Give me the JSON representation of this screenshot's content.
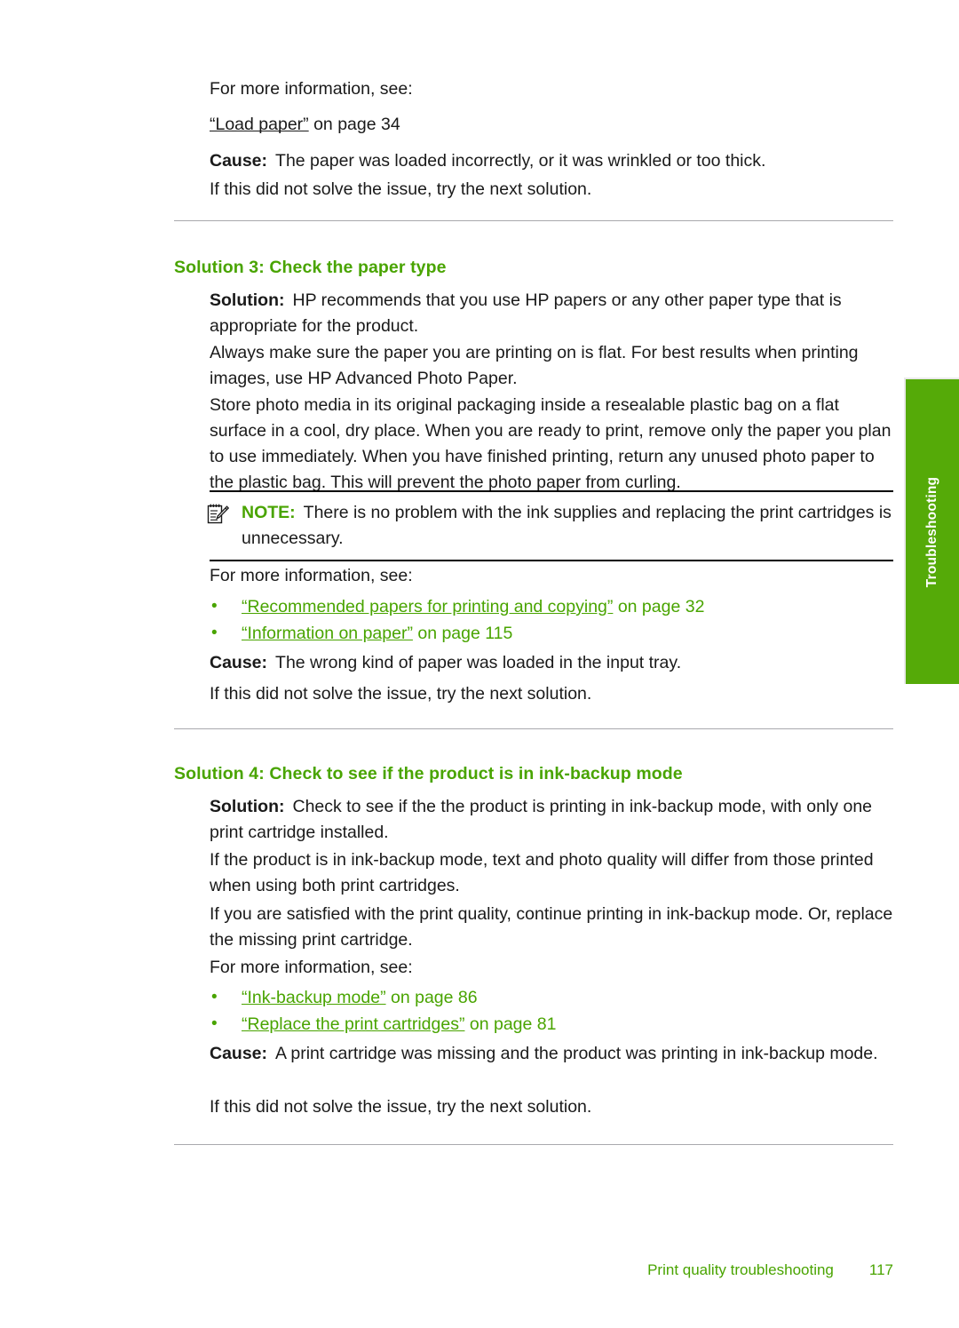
{
  "side_tab": {
    "label": "Troubleshooting",
    "color": "#55aa08"
  },
  "top_section": {
    "for_more_info": "For more information, see:",
    "link": {
      "quoted": "“Load paper”",
      "suffix": " on page 34"
    },
    "cause_label": "Cause:",
    "cause_text": "The paper was loaded incorrectly, or it was wrinkled or too thick.",
    "next_solution": "If this did not solve the issue, try the next solution."
  },
  "solution3": {
    "heading": "Solution 3: Check the paper type",
    "solution_label": "Solution:",
    "solution_text": "HP recommends that you use HP papers or any other paper type that is appropriate for the product.",
    "paragraph2": "Always make sure the paper you are printing on is flat. For best results when printing images, use HP Advanced Photo Paper.",
    "paragraph3": "Store photo media in its original packaging inside a resealable plastic bag on a flat surface in a cool, dry place. When you are ready to print, remove only the paper you plan to use immediately. When you have finished printing, return any unused photo paper to the plastic bag. This will prevent the photo paper from curling.",
    "note": {
      "icon": "note-pad-pencil-icon",
      "keyword": "NOTE:",
      "text": "There is no problem with the ink supplies and replacing the print cartridges is unnecessary."
    },
    "for_more_info": "For more information, see:",
    "links": [
      {
        "quoted": "“Recommended papers for printing and copying”",
        "suffix": " on page 32"
      },
      {
        "quoted": "“Information on paper”",
        "suffix": " on page 115"
      }
    ],
    "cause_label": "Cause:",
    "cause_text": "The wrong kind of paper was loaded in the input tray.",
    "next_solution": "If this did not solve the issue, try the next solution."
  },
  "solution4": {
    "heading": "Solution 4: Check to see if the product is in ink-backup mode",
    "solution_label": "Solution:",
    "solution_text": "Check to see if the the product is printing in ink-backup mode, with only one print cartridge installed.",
    "paragraph2": "If the product is in ink-backup mode, text and photo quality will differ from those printed when using both print cartridges.",
    "paragraph3": "If you are satisfied with the print quality, continue printing in ink-backup mode. Or, replace the missing print cartridge.",
    "for_more_info": "For more information, see:",
    "links": [
      {
        "quoted": "“Ink-backup mode”",
        "suffix": " on page 86"
      },
      {
        "quoted": "“Replace the print cartridges”",
        "suffix": " on page 81"
      }
    ],
    "cause_label": "Cause:",
    "cause_text": "A print cartridge was missing and the product was printing in ink-backup mode.",
    "next_solution": "If this did not solve the issue, try the next solution."
  },
  "footer": {
    "title": "Print quality troubleshooting",
    "page_number": "117"
  }
}
